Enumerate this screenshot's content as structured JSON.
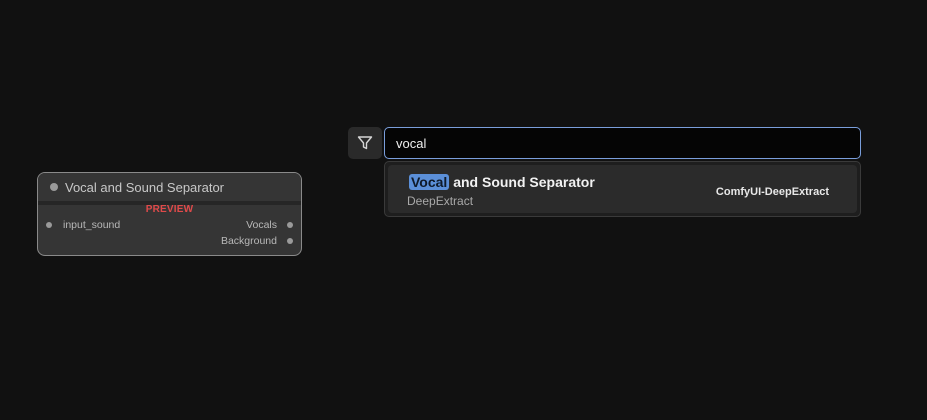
{
  "node_preview": {
    "title": "Vocal and Sound Separator",
    "badge": "PREVIEW",
    "inputs": [
      {
        "label": "input_sound"
      }
    ],
    "outputs": [
      {
        "label": "Vocals"
      },
      {
        "label": "Background"
      }
    ]
  },
  "search": {
    "value": "vocal",
    "filter_icon": "filter-icon"
  },
  "results": [
    {
      "title_match": "Vocal",
      "title_rest": " and Sound Separator",
      "category": "DeepExtract",
      "source": "ComfyUI-DeepExtract"
    }
  ],
  "colors": {
    "canvas_bg": "#111111",
    "accent": "#5b8fd8",
    "input_border": "#7a9edb",
    "preview_badge": "#e04a4a"
  }
}
